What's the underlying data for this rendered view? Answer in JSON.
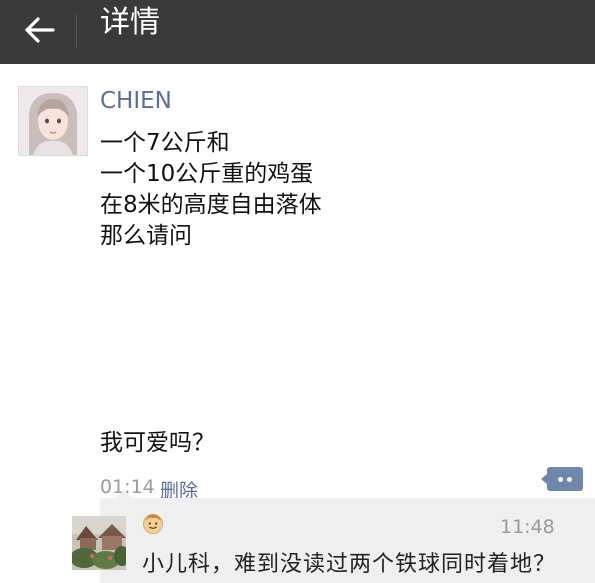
{
  "header": {
    "back_icon": "arrow-left-icon",
    "title": "详情"
  },
  "post": {
    "author": "CHIEN",
    "avatar_icon": "girl-avatar-photo",
    "body": "一个7公斤和\n一个10公斤重的鸡蛋\n在8米的高度自由落体\n那么请问",
    "body_end": "我可爱吗？",
    "time": "01:14",
    "delete_label": "删除",
    "comment_icon": "more-dots-icon"
  },
  "comments": {
    "commenter_avatar": "garden-photo-avatar",
    "like_icon": "smiley-face-icon",
    "time": "11:48",
    "text": "小儿科，难到没读过两个铁球同时着地？"
  },
  "colors": {
    "header_bg": "#3a3a3a",
    "link_blue": "#5a6d96",
    "comment_bg": "#efefef"
  }
}
